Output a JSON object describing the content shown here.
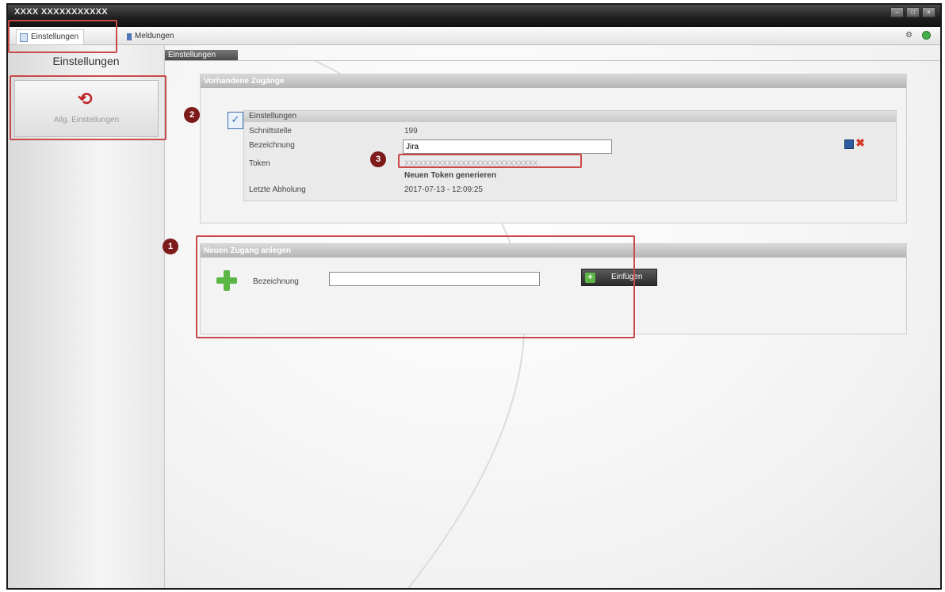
{
  "window": {
    "title": "XXXX XXXXXXXXXXX"
  },
  "tabs": [
    {
      "label": "Einstellungen"
    },
    {
      "label": "Meldungen"
    }
  ],
  "sidebar": {
    "title": "Einstellungen",
    "tile_label": "Allg. Einstellungen"
  },
  "main": {
    "header": "Einstellungen",
    "existing_panel": {
      "title": "Vorhandene Zugänge",
      "inner_title": "Einstellungen",
      "fields": {
        "schnittstelle_label": "Schnittstelle",
        "schnittstelle_value": "199",
        "bezeichnung_label": "Bezeichnung",
        "bezeichnung_value": "Jira",
        "token_label": "Token",
        "token_value": "XXXXXXXXXXXXXXXXXXXXXXXXXXXX",
        "new_token_label": "Neuen Token generieren",
        "last_fetch_label": "Letzte Abholung",
        "last_fetch_value": "2017-07-13 - 12:09:25"
      }
    },
    "new_panel": {
      "title": "Neuen Zugang anlegen",
      "bezeichnung_label": "Bezeichnung",
      "bezeichnung_value": "",
      "add_button": "Einfügen"
    }
  },
  "annotations": {
    "one": "1",
    "two": "2",
    "three": "3"
  }
}
